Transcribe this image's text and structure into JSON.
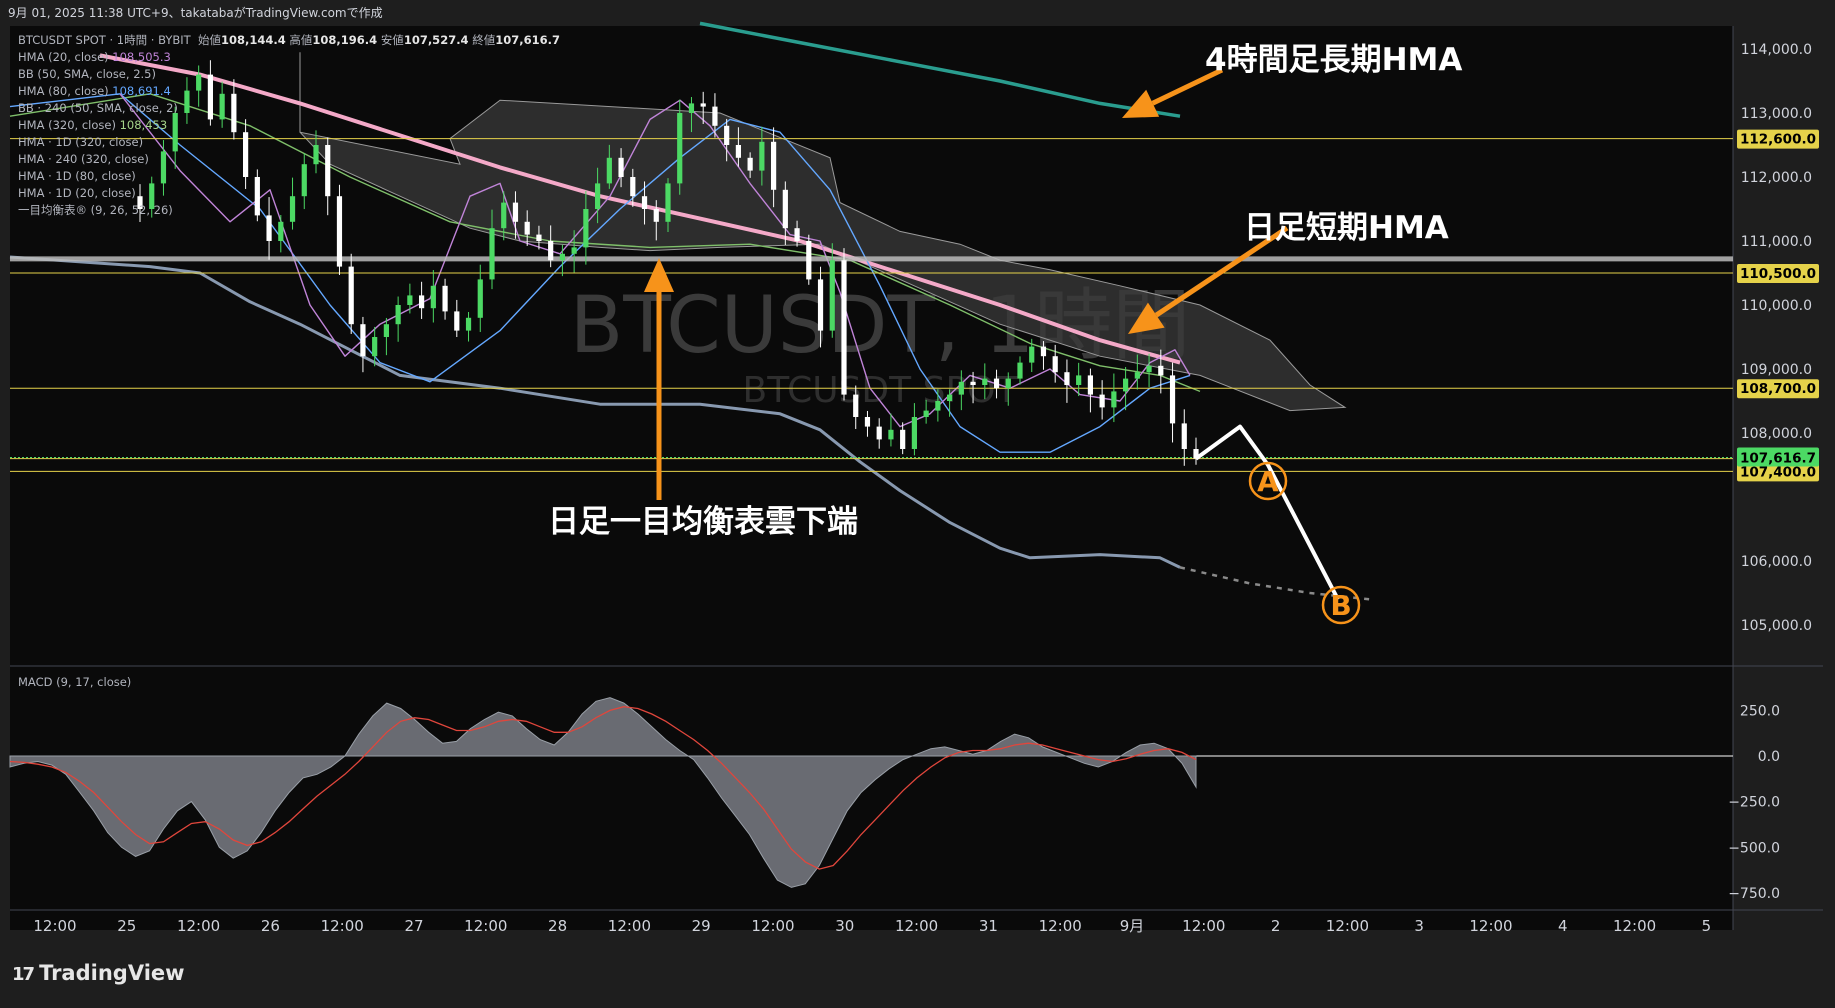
{
  "header": {
    "datetime": "9月 01, 2025 11:38 UTC+9、takatabaがTradingView.comで作成",
    "symbol_line": "BTCUSDT SPOT · 1時間 · BYBIT",
    "open_label": "始値",
    "open": "108,144.4",
    "high_label": "高値",
    "high": "108,196.4",
    "low_label": "安値",
    "low": "107,527.4",
    "close_label": "終値",
    "close": "107,616.7"
  },
  "legend": [
    {
      "label": "HMA (20, close)",
      "value": "108,505.3",
      "color": "#c084d8"
    },
    {
      "label": "BB (50, SMA, close, 2.5)",
      "value": "",
      "color": ""
    },
    {
      "label": "HMA (80, close)",
      "value": "108,691.4",
      "color": "#64a8ff"
    },
    {
      "label": "BB · 240 (50, SMA, close, 2)",
      "value": "",
      "color": ""
    },
    {
      "label": "HMA (320, close)",
      "value": "108,453",
      "color": "#a5d48a"
    },
    {
      "label": "HMA · 1D (320, close)",
      "value": "",
      "color": ""
    },
    {
      "label": "HMA · 240 (320, close)",
      "value": "",
      "color": ""
    },
    {
      "label": "HMA · 1D (80, close)",
      "value": "",
      "color": ""
    },
    {
      "label": "HMA · 1D (20, close)",
      "value": "",
      "color": ""
    },
    {
      "label": "一目均衡表® (9, 26, 52, 26)",
      "value": "",
      "color": ""
    }
  ],
  "watermark": {
    "title": "BTCUSDT, 1時間",
    "subtitle": "BTCUSDT SPOT"
  },
  "annotations": {
    "hma_4h_long": "4時間足長期HMA",
    "hma_1d_short": "日足短期HMA",
    "ichimoku_cloud_bottom": "日足一目均衡表雲下端",
    "marker_a": "A",
    "marker_b": "B"
  },
  "macd_label": "MACD (9, 17, close)",
  "brand": "TradingView",
  "colors": {
    "up": "#4cd964",
    "down": "#ffffff",
    "pink": "#f4a9c8",
    "teal": "#2a9d8f",
    "orange": "#f7931a",
    "yellow": "#e5d24a",
    "price_tag": "#4cd964"
  },
  "chart_data": [
    {
      "type": "candlestick",
      "title": "BTCUSDT, 1時間",
      "yaxis_ticks": [
        "114,000.0",
        "113,000.0",
        "112,000.0",
        "111,000.0",
        "110,000.0",
        "109,000.0",
        "108,000.0",
        "106,000.0",
        "105,000.0"
      ],
      "ylim": [
        104300,
        114400
      ],
      "xaxis_ticks": [
        "12:00",
        "25",
        "12:00",
        "26",
        "12:00",
        "27",
        "12:00",
        "28",
        "12:00",
        "29",
        "12:00",
        "30",
        "12:00",
        "31",
        "12:00",
        "9月",
        "12:00",
        "2",
        "12:00",
        "3",
        "12:00",
        "4",
        "12:00",
        "5"
      ],
      "horizontal_levels": [
        {
          "price": 112600,
          "label": "112,600.0",
          "color": "#e5d24a"
        },
        {
          "price": 110500,
          "label": "110,500.0",
          "color": "#e5d24a"
        },
        {
          "price": 108700,
          "label": "108,700.0",
          "color": "#e5d24a"
        },
        {
          "price": 107600,
          "label": "107,600.0",
          "color": "#e5d24a"
        },
        {
          "price": 107400,
          "label": "107,400.0",
          "color": "#e5d24a"
        }
      ],
      "current_price": {
        "price": 107616.7,
        "label": "107,616.7"
      },
      "gray_level": 110720,
      "close_path": [
        111500,
        111900,
        112400,
        113000,
        113350,
        113600,
        112900,
        113300,
        112700,
        112000,
        111400,
        111000,
        111300,
        111700,
        112200,
        112500,
        111700,
        110600,
        109700,
        109200,
        109500,
        109700,
        110000,
        110150,
        109950,
        110300,
        109900,
        109600,
        109800,
        110400,
        111200,
        111600,
        111300,
        111100,
        111000,
        110700,
        110800,
        110900,
        111500,
        111900,
        112300,
        112000,
        111700,
        111500,
        111300,
        111900,
        113000,
        113150,
        113100,
        112800,
        112500,
        112300,
        112100,
        112550,
        111800,
        111200,
        111000,
        110400,
        109600,
        110700,
        108600,
        108250,
        108100,
        107900,
        108050,
        107750,
        108250,
        108350,
        108500,
        108600,
        108800,
        108750,
        108850,
        108700,
        108850,
        109100,
        109350,
        109200,
        108950,
        108750,
        108900,
        108600,
        108400,
        108650,
        108850,
        108950,
        109050,
        108900,
        108150,
        107750,
        107600
      ],
      "projection": [
        {
          "x_label": "12:00",
          "price": 107600
        },
        {
          "price": 108100
        },
        {
          "label": "A",
          "price": 107500
        },
        {
          "label": "B",
          "price": 105400
        }
      ]
    },
    {
      "type": "area",
      "title": "MACD (9, 17, close)",
      "yaxis_ticks": [
        "250.0",
        "0.0",
        "−250.0",
        "−500.0",
        "−750.0"
      ],
      "ylim": [
        -800,
        320
      ],
      "macd": [
        -60,
        -40,
        -30,
        -50,
        -100,
        -200,
        -300,
        -420,
        -500,
        -550,
        -520,
        -400,
        -300,
        -250,
        -350,
        -500,
        -560,
        -520,
        -420,
        -300,
        -200,
        -120,
        -100,
        -60,
        0,
        120,
        220,
        290,
        260,
        200,
        130,
        70,
        80,
        150,
        200,
        240,
        220,
        150,
        90,
        60,
        130,
        230,
        300,
        320,
        290,
        230,
        160,
        90,
        30,
        -20,
        -120,
        -230,
        -330,
        -430,
        -560,
        -680,
        -720,
        -700,
        -600,
        -450,
        -300,
        -200,
        -130,
        -70,
        -20,
        10,
        40,
        50,
        30,
        10,
        30,
        80,
        120,
        100,
        50,
        20,
        -10,
        -40,
        -60,
        -30,
        20,
        60,
        70,
        40,
        -40,
        -170
      ],
      "signal": [
        -30,
        -35,
        -45,
        -60,
        -90,
        -140,
        -200,
        -280,
        -360,
        -430,
        -480,
        -470,
        -420,
        -370,
        -360,
        -400,
        -460,
        -490,
        -470,
        -420,
        -360,
        -290,
        -220,
        -160,
        -100,
        -30,
        50,
        130,
        190,
        210,
        200,
        170,
        140,
        140,
        160,
        190,
        200,
        190,
        160,
        130,
        130,
        160,
        210,
        250,
        270,
        260,
        230,
        190,
        140,
        90,
        30,
        -40,
        -120,
        -200,
        -290,
        -400,
        -510,
        -580,
        -620,
        -600,
        -520,
        -430,
        -350,
        -270,
        -190,
        -120,
        -60,
        -10,
        20,
        30,
        30,
        40,
        60,
        70,
        60,
        40,
        20,
        0,
        -20,
        -30,
        -15,
        10,
        30,
        40,
        20,
        -20
      ]
    }
  ]
}
